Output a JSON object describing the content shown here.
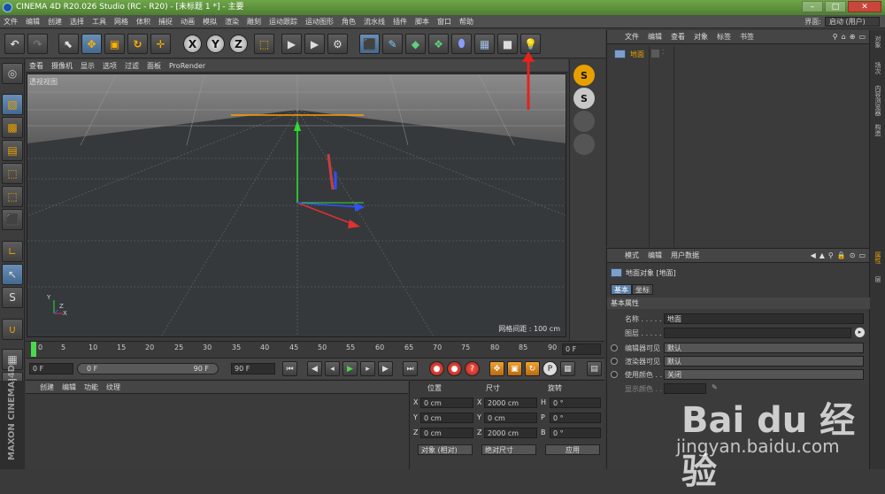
{
  "window": {
    "title": "CINEMA 4D R20.026 Studio (RC - R20) - [未标题 1 *] - 主要"
  },
  "menubar": [
    "文件",
    "编辑",
    "创建",
    "选择",
    "工具",
    "网格",
    "体积",
    "捕捉",
    "动画",
    "模拟",
    "渲染",
    "雕刻",
    "运动跟踪",
    "运动图形",
    "角色",
    "流水线",
    "插件",
    "脚本",
    "窗口",
    "帮助"
  ],
  "layout": {
    "label": "界面:",
    "value": "启动 (用户)"
  },
  "toolbar": {
    "x_label": "X",
    "y_label": "Y",
    "z_label": "Z"
  },
  "viewport": {
    "menu": [
      "查看",
      "摄像机",
      "显示",
      "选项",
      "过滤",
      "面板",
      "ProRender"
    ],
    "label": "透视视图",
    "grid_text": "网格间距 : 100 cm",
    "axis_y": "Y",
    "axis_x": "X",
    "axis_z": "Z"
  },
  "rightbar": {
    "s1": "S",
    "s2": "S"
  },
  "timeline": {
    "ticks": [
      "0",
      "5",
      "10",
      "15",
      "20",
      "25",
      "30",
      "35",
      "40",
      "45",
      "50",
      "55",
      "60",
      "65",
      "70",
      "75",
      "80",
      "85",
      "90"
    ],
    "current_frame": "0 F"
  },
  "transport": {
    "start": "0 F",
    "range_start": "0 F",
    "range_end": "90 F",
    "end": "90 F"
  },
  "materials": {
    "menu": [
      "创建",
      "编辑",
      "功能",
      "纹理"
    ],
    "brand1": "MAXON",
    "brand2": "CINEMA 4D"
  },
  "coords": {
    "headers": [
      "位置",
      "尺寸",
      "旋转"
    ],
    "rows": [
      {
        "a": "X",
        "v1": "0 cm",
        "b": "X",
        "v2": "2000 cm",
        "c": "H",
        "v3": "0 °"
      },
      {
        "a": "Y",
        "v1": "0 cm",
        "b": "Y",
        "v2": "0 cm",
        "c": "P",
        "v3": "0 °"
      },
      {
        "a": "Z",
        "v1": "0 cm",
        "b": "Z",
        "v2": "2000 cm",
        "c": "B",
        "v3": "0 °"
      }
    ],
    "mode1": "对象 (相对)",
    "mode2": "绝对尺寸",
    "apply": "应用"
  },
  "objects": {
    "menu": [
      "文件",
      "编辑",
      "查看",
      "对象",
      "标签",
      "书签"
    ],
    "items": [
      {
        "name": "地面"
      }
    ]
  },
  "sidetabs": [
    "对象",
    "场次",
    "内容浏览器",
    "构造",
    "属性",
    "层"
  ],
  "attributes": {
    "menu": [
      "模式",
      "编辑",
      "用户数据"
    ],
    "object_title": "地面对象 [地面]",
    "tabs": [
      "基本",
      "坐标"
    ],
    "section": "基本属性",
    "fields": [
      {
        "label": "名称 . . . . . .",
        "value": "地面"
      },
      {
        "label": "图层 . . . . . .",
        "value": ""
      },
      {
        "label": "编辑器可见",
        "value": "默认"
      },
      {
        "label": "渲染器可见",
        "value": "默认"
      },
      {
        "label": "使用颜色 . . .",
        "value": "关闭"
      },
      {
        "label": "显示颜色 . . .",
        "value": ""
      }
    ]
  },
  "watermark": {
    "logo": "Bai du 经验",
    "url": "jingyan.baidu.com"
  },
  "colors": {
    "accent": "#e8a000",
    "active_blue": "#5a7ea8",
    "titlebar": "#5d9238"
  }
}
